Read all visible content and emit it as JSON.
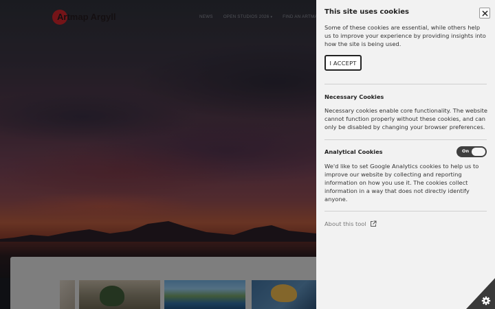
{
  "site": {
    "logo_text": "Artmap Argyll",
    "nav": [
      {
        "label": "NEWS",
        "has_caret": false
      },
      {
        "label": "OPEN STUDIOS 2026",
        "has_caret": true
      },
      {
        "label": "FIND AN ARTMAP ME",
        "has_caret": false
      }
    ],
    "caret_glyph": "▾"
  },
  "cookie_panel": {
    "title": "This site uses cookies",
    "close_icon": "close-icon",
    "intro": "Some of these cookies are essential, while others help us to improve your experience by providing insights into how the site is being used.",
    "accept_label": "I ACCEPT",
    "sections": [
      {
        "heading": "Necessary Cookies",
        "body": "Necessary cookies enable core functionality. The website cannot function properly without these cookies, and can only be disabled by changing your browser preferences."
      },
      {
        "heading": "Analytical Cookies",
        "body": "We'd like to set Google Analytics cookies to help us to improve our website by collecting and reporting information on how you use it. The cookies collect information in a way that does not directly identify anyone.",
        "toggle_label": "On",
        "toggle_on": true
      }
    ],
    "about_label": "About this tool",
    "about_icon": "external-link-icon"
  },
  "corner_button": {
    "icon": "gear-icon"
  },
  "colors": {
    "logo_red": "#c8242a",
    "panel_bg": "#f2f2f2",
    "toggle_bg": "#3f3f3f",
    "corner_bg": "#3a3a3a"
  }
}
